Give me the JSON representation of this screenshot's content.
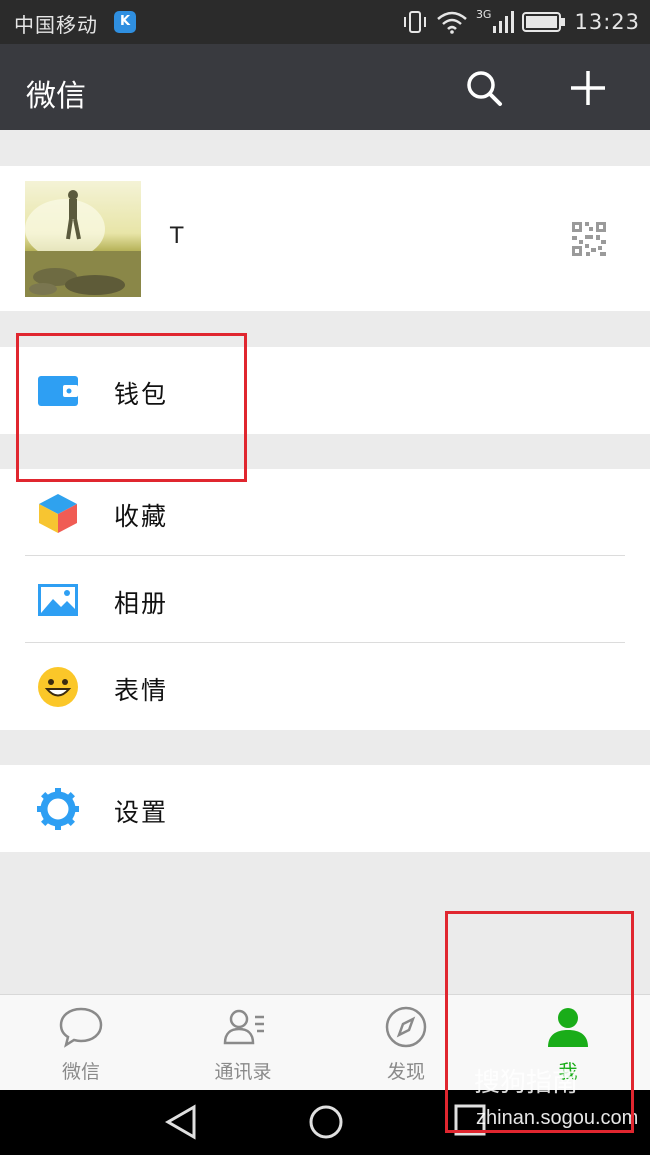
{
  "status_bar": {
    "carrier": "中国移动",
    "carrier_badge": "K",
    "network": "3G",
    "time": "13:23"
  },
  "header": {
    "title": "微信"
  },
  "profile": {
    "name": "T"
  },
  "menu": {
    "wallet": "钱包",
    "favorites": "收藏",
    "album": "相册",
    "stickers": "表情",
    "settings": "设置"
  },
  "tabs": [
    {
      "label": "微信",
      "icon": "chat-bubble-icon",
      "active": false
    },
    {
      "label": "通讯录",
      "icon": "contacts-icon",
      "active": false
    },
    {
      "label": "发现",
      "icon": "compass-icon",
      "active": false
    },
    {
      "label": "我",
      "icon": "person-icon",
      "active": true
    }
  ],
  "colors": {
    "accent": "#1aad19",
    "header_bg": "#393a3f",
    "highlight_box": "#e0262f"
  },
  "watermark": {
    "text": "搜狗指南",
    "url": "zhinan.sogou.com"
  }
}
